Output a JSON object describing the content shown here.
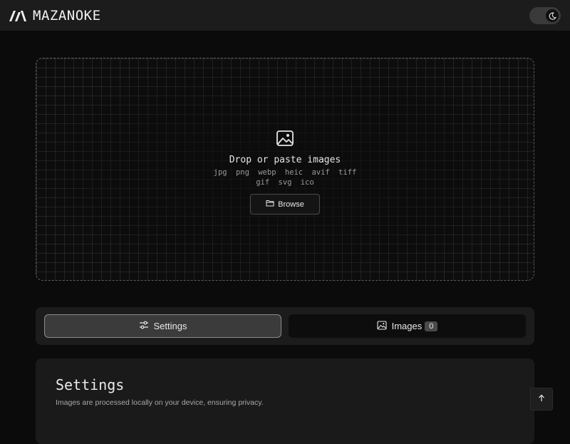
{
  "header": {
    "app_name": "MAZANOKE",
    "logo_icon": "mazanoke-logo",
    "theme_toggle_icon": "moon-icon"
  },
  "dropzone": {
    "icon": "image-icon",
    "title": "Drop or paste images",
    "formats_line1": "jpg png webp heic avif tiff",
    "formats_line2": "gif svg ico",
    "browse_label": "Browse",
    "browse_icon": "folder-icon"
  },
  "tabs": {
    "settings_label": "Settings",
    "settings_icon": "sliders-icon",
    "images_label": "Images",
    "images_icon": "image-icon",
    "images_count": "0",
    "active": "settings"
  },
  "settings_panel": {
    "title": "Settings",
    "subtitle": "Images are processed locally on your device, ensuring privacy."
  },
  "scroll_top_icon": "arrow-up-icon",
  "colors": {
    "background": "#0b0b0b",
    "header": "#1c1c1c",
    "panel": "#1a1a1a",
    "active_tab": "#3b3b3b"
  }
}
